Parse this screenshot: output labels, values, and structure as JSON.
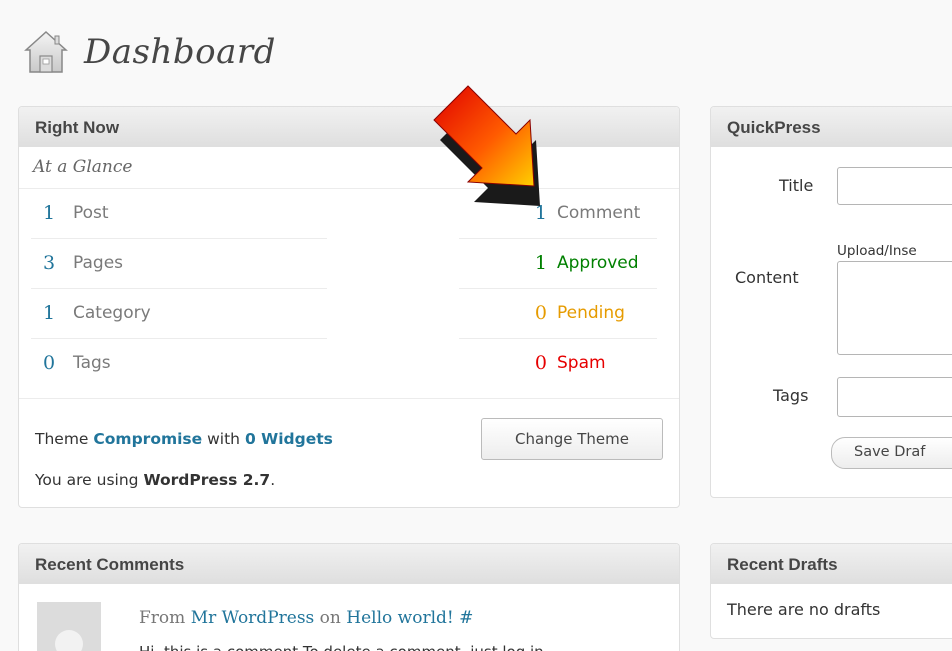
{
  "page": {
    "title": "Dashboard"
  },
  "right_now": {
    "title": "Right Now",
    "subtitle": "At a Glance",
    "content": [
      {
        "count": "1",
        "label": "Post"
      },
      {
        "count": "3",
        "label": "Pages"
      },
      {
        "count": "1",
        "label": "Category"
      },
      {
        "count": "0",
        "label": "Tags"
      }
    ],
    "discussion": [
      {
        "count": "1",
        "label": "Comment"
      },
      {
        "count": "1",
        "label": "Approved"
      },
      {
        "count": "0",
        "label": "Pending"
      },
      {
        "count": "0",
        "label": "Spam"
      }
    ],
    "theme_prefix": "Theme",
    "theme_name": "Compromise",
    "theme_with": "with",
    "widgets_link": "0 Widgets",
    "version_prefix": "You are using",
    "version": "WordPress 2.7",
    "version_suffix": ".",
    "change_theme_button": "Change Theme"
  },
  "recent_comments": {
    "title": "Recent Comments",
    "from": "From",
    "author": "Mr WordPress",
    "on": "on",
    "post": "Hello world!",
    "hash": "#",
    "excerpt": "Hi, this is a comment.To delete a comment, just log in"
  },
  "quickpress": {
    "title": "QuickPress",
    "title_label": "Title",
    "upload_label": "Upload/Inse",
    "content_label": "Content",
    "tags_label": "Tags",
    "save_draft_button": "Save Draf"
  },
  "recent_drafts": {
    "title": "Recent Drafts",
    "empty_text": "There are no drafts"
  },
  "colors": {
    "link": "#21759b",
    "approved": "#008000",
    "pending": "#e69b00",
    "spam": "#e60000"
  }
}
